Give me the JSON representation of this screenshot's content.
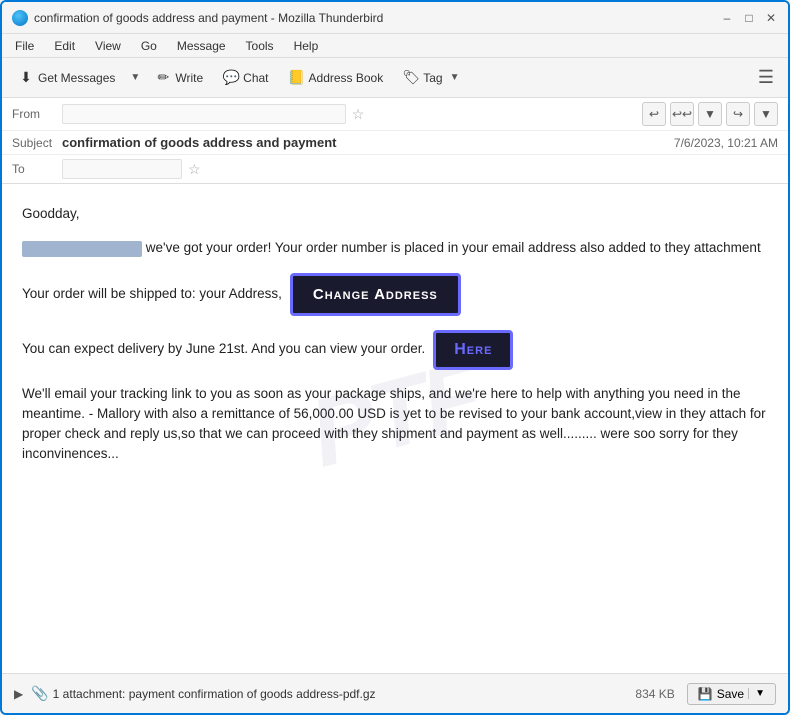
{
  "window": {
    "title": "confirmation of goods address and payment - Mozilla Thunderbird",
    "app_icon_alt": "thunderbird-icon"
  },
  "menu": {
    "items": [
      "File",
      "Edit",
      "View",
      "Go",
      "Message",
      "Tools",
      "Help"
    ]
  },
  "toolbar": {
    "get_messages_label": "Get Messages",
    "write_label": "Write",
    "chat_label": "Chat",
    "address_book_label": "Address Book",
    "tag_label": "Tag"
  },
  "header": {
    "from_label": "From",
    "from_value": "",
    "subject_label": "Subject",
    "subject_value": "confirmation of goods address and payment",
    "date_value": "7/6/2023, 10:21 AM",
    "to_label": "To",
    "to_value": ""
  },
  "email": {
    "greeting": "Goodday,",
    "paragraph1_suffix": "we've got your order! Your order number is placed in your email address also added to they attachment",
    "paragraph2_prefix": "Your order will be shipped to: your Address,",
    "change_address_btn": "Change Address",
    "paragraph3_prefix": "You can expect delivery by June 21st. And you can view your order.",
    "here_btn": "Here",
    "paragraph4": "We'll email your tracking link to you as soon as your package ships, and we're here to help with anything you need in the meantime. - Mallory with also a remittance of 56,000.00 USD is yet to be revised to your bank account,view in they attach for proper check and reply us,so that we  can proceed with they shipment and payment as well......... were soo sorry for they inconvinences..."
  },
  "attachment": {
    "label": "1 attachment: payment confirmation of goods address-pdf.gz",
    "size": "834 KB",
    "save_label": "Save"
  }
}
